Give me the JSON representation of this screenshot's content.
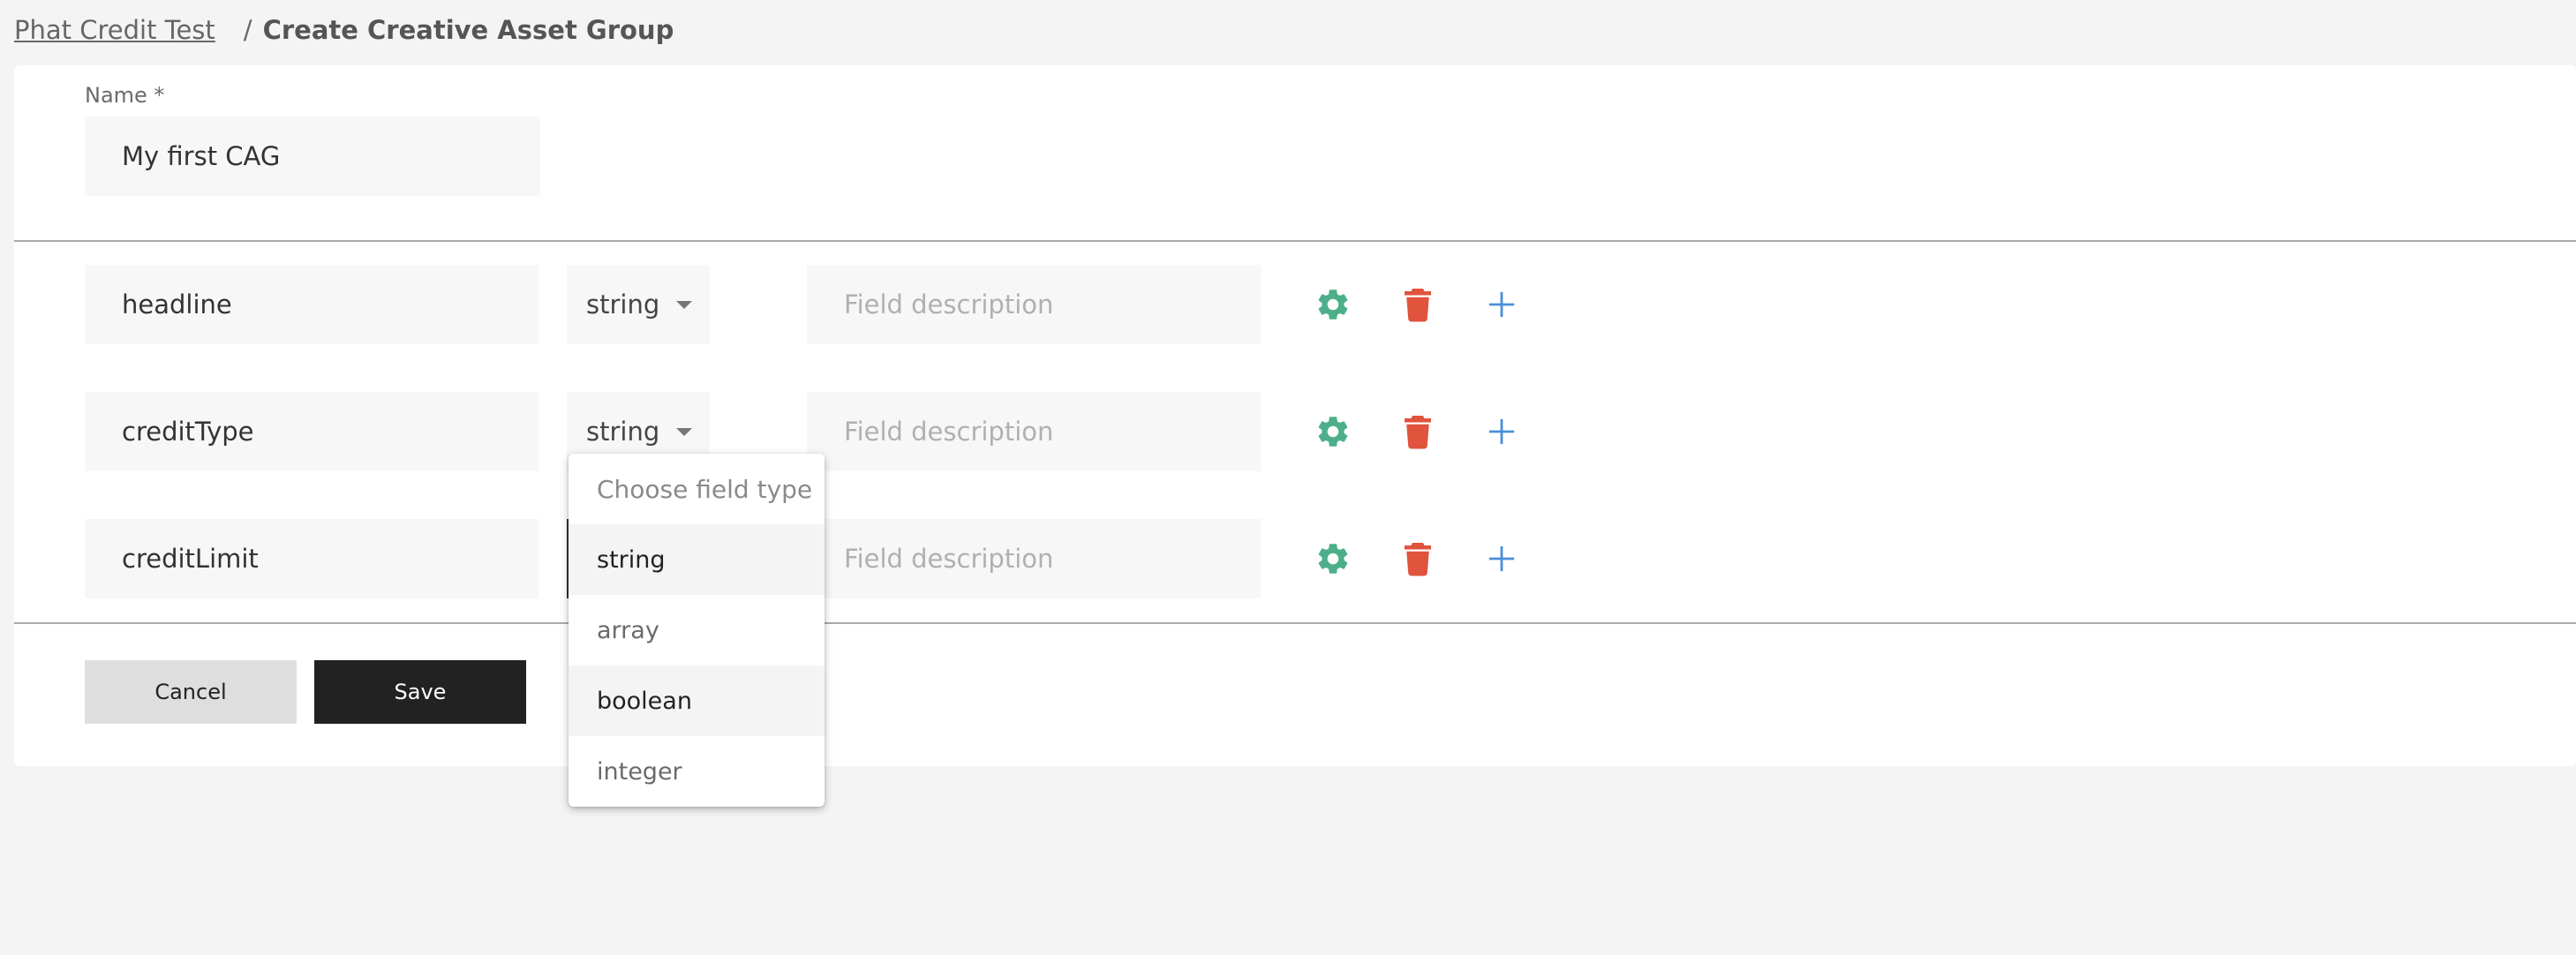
{
  "breadcrumb": {
    "parent": "Phat Credit Test",
    "separator": "/",
    "current": "Create Creative Asset Group"
  },
  "form": {
    "name_label": "Name *",
    "name_value": "My first CAG"
  },
  "fields": [
    {
      "name": "headline",
      "type": "string",
      "description_placeholder": "Field description"
    },
    {
      "name": "creditType",
      "type": "string",
      "description_placeholder": "Field description"
    },
    {
      "name": "creditLimit",
      "type": "",
      "description_placeholder": "Field description"
    }
  ],
  "row_icons": {
    "settings": "gear-icon",
    "delete": "trash-icon",
    "add": "plus-icon"
  },
  "actions": {
    "cancel_label": "Cancel",
    "save_label": "Save"
  },
  "type_dropdown": {
    "header": "Choose field type",
    "options": [
      "string",
      "array",
      "boolean",
      "integer"
    ],
    "selected": "string",
    "hovered": "boolean"
  },
  "colors": {
    "gear": "#4caf8a",
    "trash": "#e0533c",
    "plus": "#4a90d9",
    "save_bg": "#222222",
    "cancel_bg": "#dedede"
  }
}
